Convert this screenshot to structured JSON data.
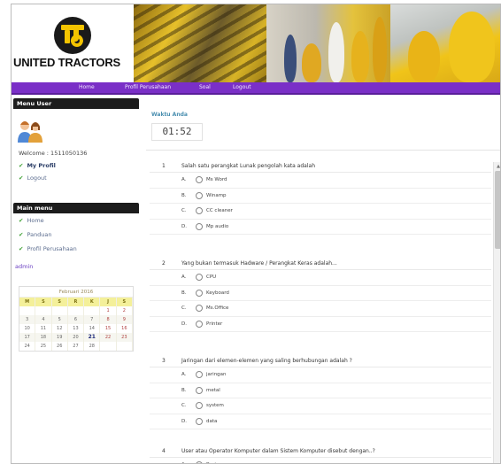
{
  "brand": {
    "name": "UNITED TRACTORS"
  },
  "nav": {
    "items": [
      "Home",
      "Profil Perusahaan",
      "Soal",
      "Logout"
    ]
  },
  "sidebar": {
    "user_menu_title": "Menu User",
    "welcome": "Welcome : 1511050136",
    "user_links": [
      {
        "label": "My Profil",
        "bold": true
      },
      {
        "label": "Logout",
        "bold": false
      }
    ],
    "main_menu_title": "Main menu",
    "main_links": [
      "Home",
      "Panduan",
      "Profil Perusahaan"
    ],
    "admin_label": "admin"
  },
  "calendar": {
    "month": "Februari 2016",
    "dow": [
      "M",
      "S",
      "S",
      "R",
      "K",
      "J",
      "S"
    ],
    "weeks": [
      [
        "",
        "",
        "",
        "",
        "",
        "1",
        "2"
      ],
      [
        "3",
        "4",
        "5",
        "6",
        "7",
        "8",
        "9"
      ],
      [
        "10",
        "11",
        "12",
        "13",
        "14",
        "15",
        "16"
      ],
      [
        "17",
        "18",
        "19",
        "20",
        "21",
        "22",
        "23"
      ],
      [
        "24",
        "25",
        "26",
        "27",
        "28",
        "",
        ""
      ]
    ],
    "today": "21"
  },
  "exam": {
    "timer_label": "Waktu Anda",
    "timer_value": "01:52",
    "questions": [
      {
        "num": "1",
        "text": "Salah satu perangkat Lunak pengolah kata adalah",
        "options": [
          {
            "letter": "A.",
            "text": "Ms Word"
          },
          {
            "letter": "B.",
            "text": "Winamp"
          },
          {
            "letter": "C.",
            "text": "CC cleaner"
          },
          {
            "letter": "D.",
            "text": "Mp audio"
          }
        ]
      },
      {
        "num": "2",
        "text": "Yang bukan termasuk Hadware / Perangkat Keras adalah...",
        "options": [
          {
            "letter": "A.",
            "text": "CPU"
          },
          {
            "letter": "B.",
            "text": "Keyboard"
          },
          {
            "letter": "C.",
            "text": "Ms.Office"
          },
          {
            "letter": "D.",
            "text": "Printer"
          }
        ]
      },
      {
        "num": "3",
        "text": "Jaringan dari elemen-elemen yang saling berhubungan adalah ?",
        "options": [
          {
            "letter": "A.",
            "text": "jaringan"
          },
          {
            "letter": "B.",
            "text": "metal"
          },
          {
            "letter": "C.",
            "text": "system"
          },
          {
            "letter": "D.",
            "text": "data"
          }
        ]
      },
      {
        "num": "4",
        "text": "User atau Operator Komputer dalam Sistem Komputer disebut dengan..?",
        "options": [
          {
            "letter": "A.",
            "text": "Brainware"
          }
        ]
      }
    ]
  },
  "colors": {
    "nav": "#7a2fc7",
    "sidebar_title": "#1c1c1c",
    "check": "#3fa134",
    "calendar_dow": "#f4f09a"
  }
}
